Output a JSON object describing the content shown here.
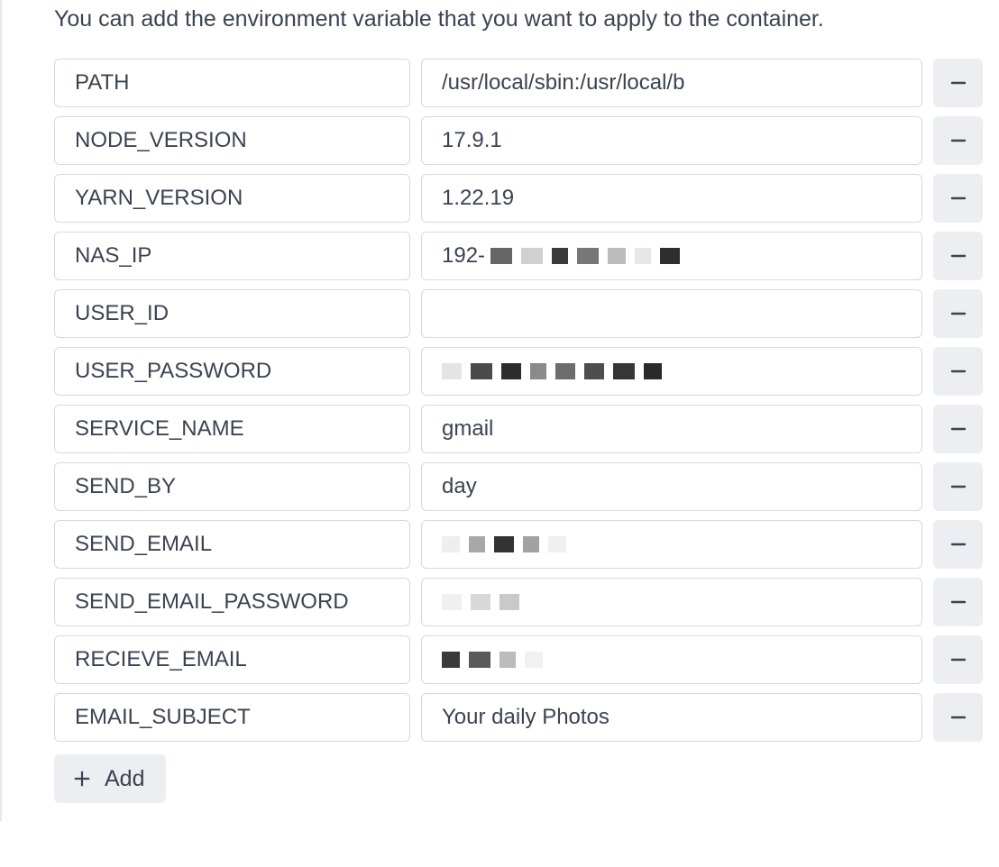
{
  "description": "You can add the environment variable that you want to apply to the container.",
  "env": [
    {
      "key": "PATH",
      "value": "/usr/local/sbin:/usr/local/b",
      "redacted": false
    },
    {
      "key": "NODE_VERSION",
      "value": "17.9.1",
      "redacted": false
    },
    {
      "key": "YARN_VERSION",
      "value": "1.22.19",
      "redacted": false
    },
    {
      "key": "NAS_IP",
      "value": "",
      "prefix": "192-",
      "redacted": true,
      "redactSet": "set1"
    },
    {
      "key": "USER_ID",
      "value": "",
      "redacted": false
    },
    {
      "key": "USER_PASSWORD",
      "value": "",
      "redacted": true,
      "redactSet": "set2"
    },
    {
      "key": "SERVICE_NAME",
      "value": "gmail",
      "redacted": false
    },
    {
      "key": "SEND_BY",
      "value": "day",
      "redacted": false
    },
    {
      "key": "SEND_EMAIL",
      "value": "",
      "redacted": true,
      "redactSet": "set3"
    },
    {
      "key": "SEND_EMAIL_PASSWORD",
      "value": "",
      "redacted": true,
      "redactSet": "set4"
    },
    {
      "key": "RECIEVE_EMAIL",
      "value": "",
      "redacted": true,
      "redactSet": "set5"
    },
    {
      "key": "EMAIL_SUBJECT",
      "value": "Your daily Photos",
      "redacted": false
    }
  ],
  "buttons": {
    "add_label": "Add"
  }
}
